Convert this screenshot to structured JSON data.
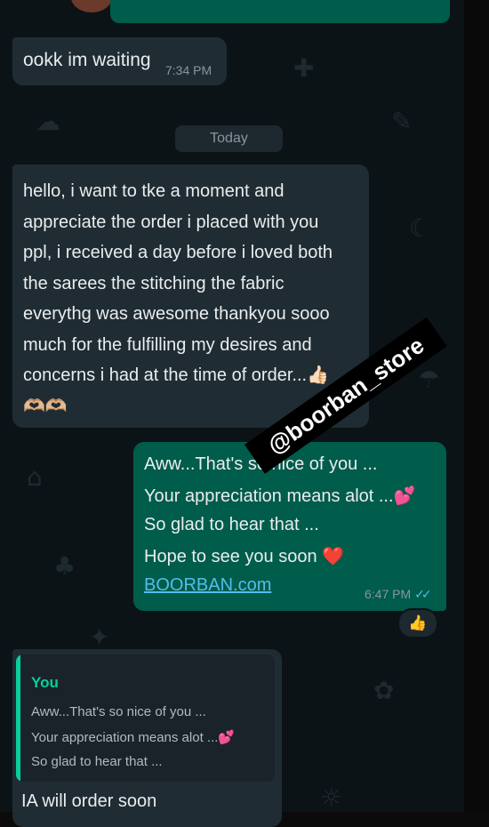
{
  "messages": {
    "m1": {
      "text": "ookk im waiting",
      "time": "7:34 PM"
    },
    "day_separator": "Today",
    "m2": {
      "text": "hello, i want to tke a moment and\nappreciate the order i placed with you\nppl, i received a day before i loved both\nthe sarees the stitching the fabric\neverythg was awesome thankyou sooo\nmuch for the fulfilling my desires and\nconcerns i had at the time of order...👍🏻\n🫶🏼🫶🏼"
    },
    "m3": {
      "line1": "Aww...That's so nice of you ...",
      "line2": "Your appreciation means alot ...💕",
      "line3": "So glad to hear that ...",
      "line4": "Hope to see you soon ❤️",
      "link": "BOORBAN.com",
      "time": "6:47 PM",
      "reaction": "👍"
    },
    "m4": {
      "quote_author": "You",
      "quote_line1": "Aww...That's so nice of you ...",
      "quote_line2": "Your appreciation means alot ...💕",
      "quote_line3": "So glad to hear that ...",
      "text": "IA will order soon"
    }
  },
  "watermark": "@boorban_store",
  "colors": {
    "chat_background": "#0c1317",
    "incoming_bubble": "#202c33",
    "outgoing_bubble": "#005c4b",
    "read_ticks": "#53bdeb",
    "quote_accent": "#06cf9c"
  },
  "icons": {
    "read_receipt": "double-check-icon"
  }
}
